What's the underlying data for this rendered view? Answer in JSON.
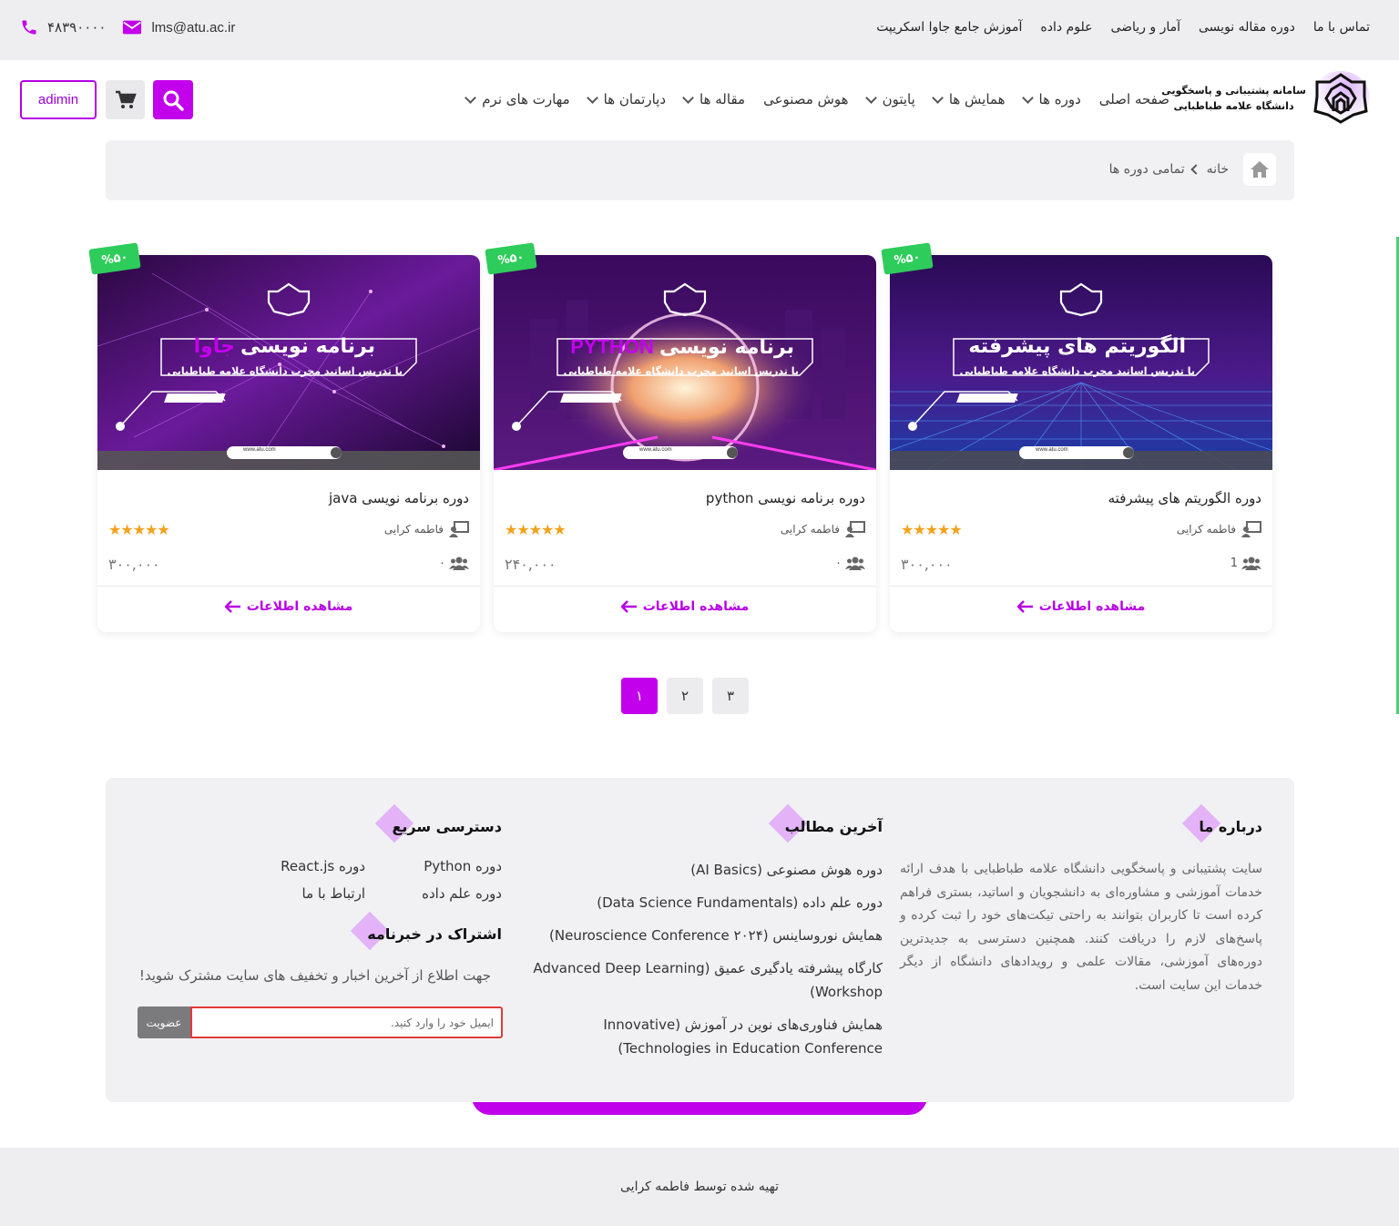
{
  "topbar": {
    "nav": [
      "تماس با ما",
      "دوره مقاله نویسی",
      "آمار و ریاضی",
      "علوم داده",
      "آموزش جامع جاوا اسکریپت"
    ],
    "email": "lms@atu.ac.ir",
    "phone": "۴۸۳۹۰۰۰۰"
  },
  "header": {
    "logo_line1": "سامانه پشتیبانی و پاسخگویی",
    "logo_line2": "دانشگاه علامه طباطبایی",
    "nav": [
      {
        "label": "صفحه اصلی",
        "dropdown": false
      },
      {
        "label": "دوره ها",
        "dropdown": true
      },
      {
        "label": "همایش ها",
        "dropdown": true
      },
      {
        "label": "پایتون",
        "dropdown": true
      },
      {
        "label": "هوش مصنوعی",
        "dropdown": false
      },
      {
        "label": "مقاله ها",
        "dropdown": true
      },
      {
        "label": "دپارتمان ها",
        "dropdown": true
      },
      {
        "label": "مهارت های نرم",
        "dropdown": true
      }
    ],
    "admin_label": "adimin"
  },
  "breadcrumb": {
    "home": "خانه",
    "current": "تمامی دوره ها"
  },
  "courses": [
    {
      "discount": "%۵۰",
      "banner_title": "الگوریتم های پیشرفته",
      "banner_highlight": "",
      "banner_subtitle": "با تدریس اساتید مجرب دانشگاه علامه طباطبایی",
      "banner_url": "www.atu.com",
      "theme": "blue",
      "title": "دوره الگوریتم های پیشرفته",
      "teacher": "فاطمه کرایی",
      "rating": 5,
      "students": "1",
      "price": "۳۰۰,۰۰۰",
      "link": "مشاهده اطلاعات"
    },
    {
      "discount": "%۵۰",
      "banner_title": "برنامه نویسی",
      "banner_highlight": "PYTHON",
      "banner_subtitle": "با تدریس اساتید مجرب دانشگاه علامه طباطبایی",
      "banner_url": "www.atu.com",
      "theme": "python",
      "title": "دوره برنامه نویسی python",
      "teacher": "فاطمه کرایی",
      "rating": 5,
      "students": "۰",
      "price": "۲۴۰,۰۰۰",
      "link": "مشاهده اطلاعات"
    },
    {
      "discount": "%۵۰",
      "banner_title": "برنامه نویسی",
      "banner_highlight": "جاوا",
      "banner_subtitle": "با تدریس اساتید مجرب دانشگاه علامه طباطبایی",
      "banner_url": "www.atu.com",
      "theme": "java",
      "title": "دوره برنامه نویسی java",
      "teacher": "فاطمه کرایی",
      "rating": 5,
      "students": "۰",
      "price": "۳۰۰,۰۰۰",
      "link": "مشاهده اطلاعات"
    }
  ],
  "pagination": [
    "۱",
    "۲",
    "۳"
  ],
  "footer": {
    "about_title": "درباره ما",
    "about_text": "سایت پشتیبانی و پاسخگویی دانشگاه علامه طباطبایی با هدف ارائه خدمات آموزشی و مشاوره‌ای به دانشجویان و اساتید، بستری فراهم کرده است تا کاربران بتوانند به راحتی تیکت‌های خود را ثبت کرده و پاسخ‌های لازم را دریافت کنند. همچنین دسترسی به جدیدترین دوره‌های آموزشی، مقالات علمی و رویدادهای دانشگاه از دیگر خدمات این سایت است.",
    "latest_title": "آخرین مطالب",
    "latest": [
      "دوره هوش مصنوعی (AI Basics)",
      "دوره علم داده (Data Science Fundamentals)",
      "همایش نوروساینس (Neuroscience Conference ۲۰۲۴)",
      "کارگاه پیشرفته یادگیری عمیق (Advanced Deep Learning Workshop)",
      "همایش فناوری‌های نوین در آموزش (Innovative Technologies in Education Conference)"
    ],
    "quick_title": "دسترسی سریع",
    "quick": [
      "دوره Python",
      "دوره React.js",
      "دوره علم داده",
      "ارتباط با ما"
    ],
    "news_title": "اشتراک در خبرنامه",
    "news_text": "جهت اطلاع از آخرین اخبار و تخفیف های سایت مشترک شوید!",
    "news_placeholder": "ایمیل خود را وارد کنید.",
    "news_button": "عضویت"
  },
  "credit": "تهیه شده توسط فاطمه کرایی",
  "colors": {
    "accent": "#c300ec",
    "badge": "#2ecc5a",
    "star": "#f4a11d"
  }
}
